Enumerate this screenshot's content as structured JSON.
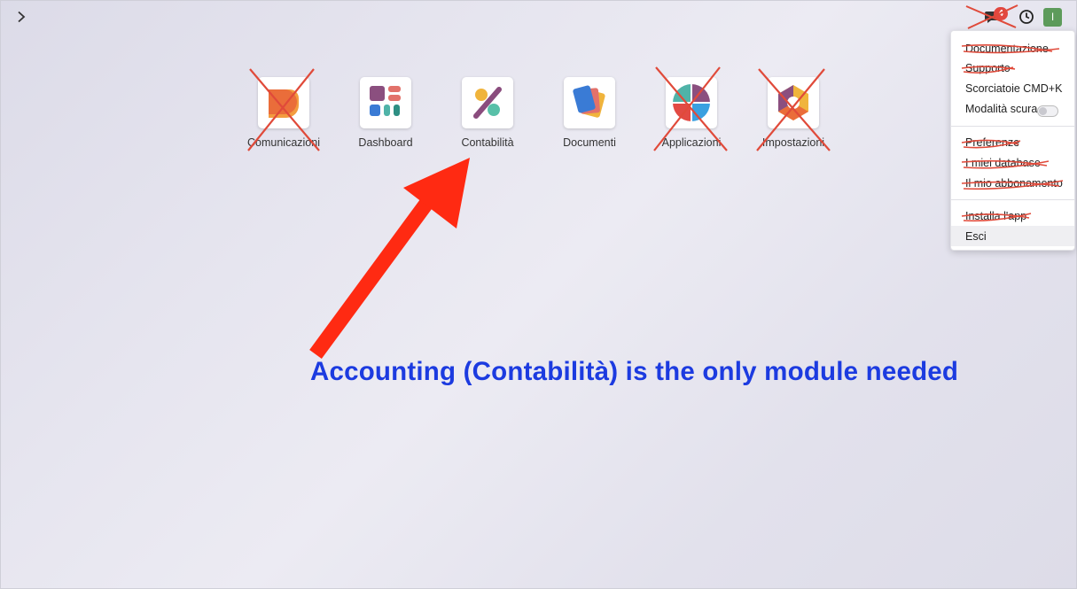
{
  "topbar": {
    "menu_icon": "chevron-right-icon",
    "chat_icon": "chat-icon",
    "chat_badge": "4",
    "activity_icon": "clock-icon",
    "avatar_initial": "I",
    "avatar_color": "#5d9b5b"
  },
  "apps": [
    {
      "label": "Comunicazioni",
      "icon": "discuss-icon",
      "crossed": true
    },
    {
      "label": "Dashboard",
      "icon": "dashboard-icon",
      "crossed": false
    },
    {
      "label": "Contabilità",
      "icon": "accounting-icon",
      "crossed": false
    },
    {
      "label": "Documenti",
      "icon": "documents-icon",
      "crossed": false
    },
    {
      "label": "Applicazioni",
      "icon": "apps-icon",
      "crossed": true
    },
    {
      "label": "Impostazioni",
      "icon": "settings-icon",
      "crossed": true
    }
  ],
  "user_menu": {
    "documentation": "Documentazione",
    "support": "Supporto",
    "shortcuts": "Scorciatoie CMD+K",
    "dark_mode": "Modalità scura",
    "preferences": "Preferenze",
    "my_databases": "I miei database",
    "my_subscription": "Il mio abbonamento",
    "install_app": "Installa l'app",
    "logout": "Esci"
  },
  "annotation": {
    "caption": "Accounting (Contabilità) is the only module needed",
    "caption_color": "#1c3be0",
    "arrow_color": "#ff2a12",
    "cross_color": "#e04a3a"
  }
}
